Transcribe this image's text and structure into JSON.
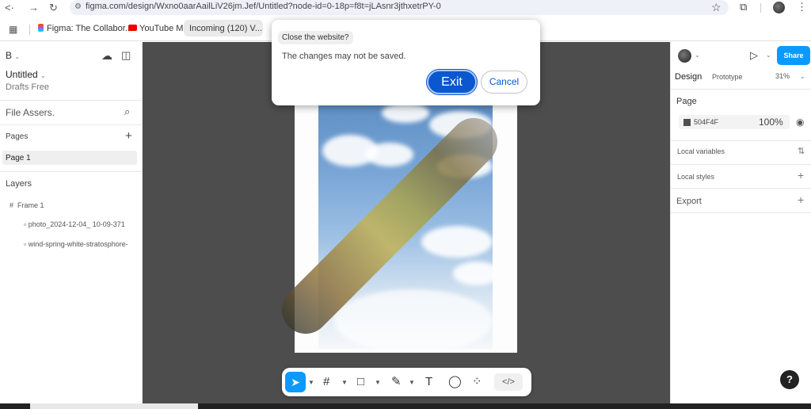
{
  "browser": {
    "url": "figma.com/design/Wxno0aarAailLiV26jm.Jef/Untitled?node-id=0-18p=f8t=jLAsnr3jthxetrPY-0",
    "bookmarks": [
      {
        "label": "Figma: The Collabor..."
      },
      {
        "label": "YouTube M"
      },
      {
        "label": "Incoming (120) V..."
      }
    ]
  },
  "left_panel": {
    "file_menu": "B",
    "file_title": "Untitled",
    "file_subtitle": "Drafts Free",
    "search_label": "File Assers.",
    "pages_header": "Pages",
    "pages": [
      "Page 1"
    ],
    "layers_header": "Layers",
    "layers": [
      {
        "label": "Frame 1",
        "depth": 0
      },
      {
        "label": "photo_2024-12-04_ 10-09-371",
        "depth": 1
      },
      {
        "label": "wind-spring-white-stratosphore-",
        "depth": 1
      }
    ]
  },
  "right_panel": {
    "share_label": "Share",
    "tabs": [
      "Design",
      "Prototype"
    ],
    "zoom": "31%",
    "page_header": "Page",
    "page_color": "504F4F",
    "page_opacity": "100%",
    "local_variables": "Local variables",
    "local_styles": "Local styles",
    "export": "Export"
  },
  "dialog": {
    "title": "Close the website?",
    "message": "The changes may not be saved.",
    "exit_label": "Exit",
    "cancel_label": "Cancel"
  },
  "toolbar": {
    "dev_mode": "</>"
  },
  "help": "?",
  "colors": {
    "canvas": "#4d4d4d",
    "figma_blue": "#0d99ff",
    "dialog_primary": "#0b57d0",
    "page_color": "#504f4f"
  }
}
